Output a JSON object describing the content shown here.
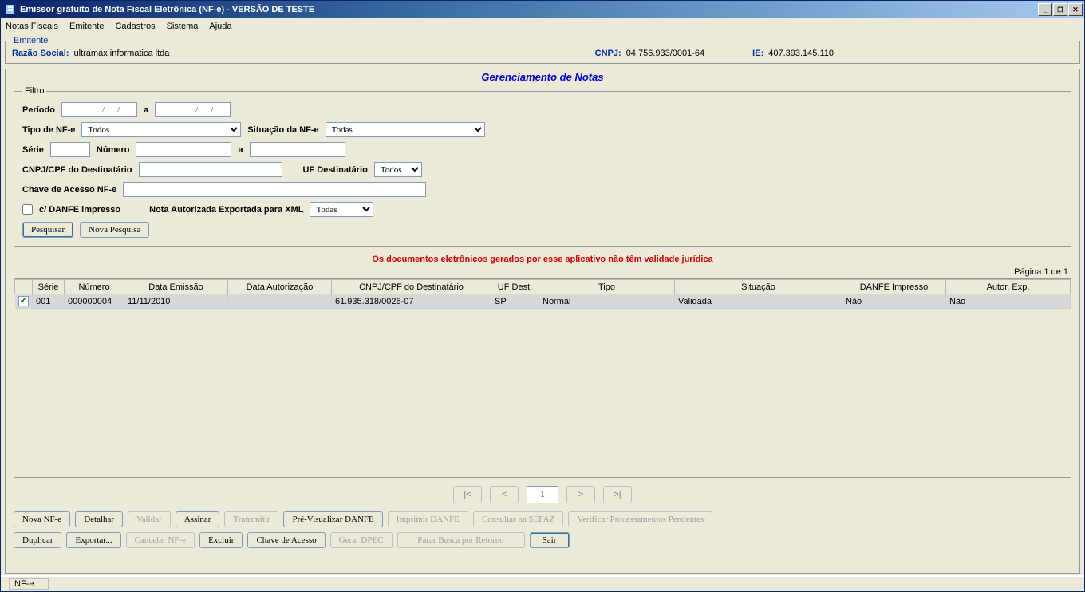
{
  "titlebar": {
    "title": "Emissor gratuito de Nota Fiscal Eletrônica (NF-e) - VERSÃO DE TESTE"
  },
  "menubar": {
    "items": [
      "Notas Fiscais",
      "Emitente",
      "Cadastros",
      "Sistema",
      "Ajuda"
    ]
  },
  "emitente": {
    "legend": "Emitente",
    "razao_label": "Razão Social:",
    "razao_value": "ultramax informatica ltda",
    "cnpj_label": "CNPJ:",
    "cnpj_value": "04.756.933/0001-64",
    "ie_label": "IE:",
    "ie_value": "407.393.145.110"
  },
  "panel": {
    "title": "Gerenciamento de Notas"
  },
  "filtro": {
    "legend": "Filtro",
    "periodo_label": "Período",
    "periodo_from": "        /    /",
    "periodo_a": "a",
    "periodo_to": "        /    /",
    "tipo_label": "Tipo de NF-e",
    "tipo_value": "Todos",
    "situacao_label": "Situação da NF-e",
    "situacao_value": "Todas",
    "serie_label": "Série",
    "numero_label": "Número",
    "numero_a": "a",
    "cnpjcpf_label": "CNPJ/CPF do Destinatário",
    "ufdest_label": "UF Destinatário",
    "ufdest_value": "Todos",
    "chave_label": "Chave de Acesso NF-e",
    "danfe_label": "c/ DANFE impresso",
    "nota_exp_label": "Nota Autorizada Exportada para XML",
    "nota_exp_value": "Todas",
    "btn_pesquisar": "Pesquisar",
    "btn_nova_pesquisa": "Nova Pesquisa"
  },
  "warning": "Os documentos eletrônicos gerados por esse aplicativo não têm validade jurídica",
  "pagination": {
    "top_text": "Página 1 de 1",
    "current_page": "1"
  },
  "table": {
    "headers": [
      "",
      "Série",
      "Número",
      "Data Emissão",
      "Data Autorização",
      "CNPJ/CPF do Destinatário",
      "UF Dest.",
      "Tipo",
      "Situação",
      "DANFE Impresso",
      "Autor. Exp."
    ],
    "rows": [
      {
        "checked": true,
        "serie": "001",
        "numero": "000000004",
        "data_emissao": "11/11/2010",
        "data_autorizacao": "",
        "cnpjcpf": "61.935.318/0026-07",
        "uf": "SP",
        "tipo": "Normal",
        "situacao": "Validada",
        "danfe": "Não",
        "autor": "Não"
      }
    ]
  },
  "nav": {
    "first": "|<",
    "prev": "<",
    "next": ">",
    "last": ">|"
  },
  "buttons_row1": {
    "nova": "Nova NF-e",
    "detalhar": "Detalhar",
    "validar": "Validar",
    "assinar": "Assinar",
    "transmitir": "Transmitir",
    "previsualizar": "Pré-Visualizar DANFE",
    "imprimir": "Imprimir DANFE",
    "consultar": "Consultar na SEFAZ",
    "verificar": "Verificar Processamentos Pendentes"
  },
  "buttons_row2": {
    "duplicar": "Duplicar",
    "exportar": "Exportar...",
    "cancelar": "Cancelar NF-e",
    "excluir": "Excluir",
    "chave": "Chave de Acesso",
    "gerardpec": "Gerar DPEC",
    "parar": "Parar Busca por Retorno",
    "sair": "Sair"
  },
  "status": {
    "text": "NF-e"
  }
}
